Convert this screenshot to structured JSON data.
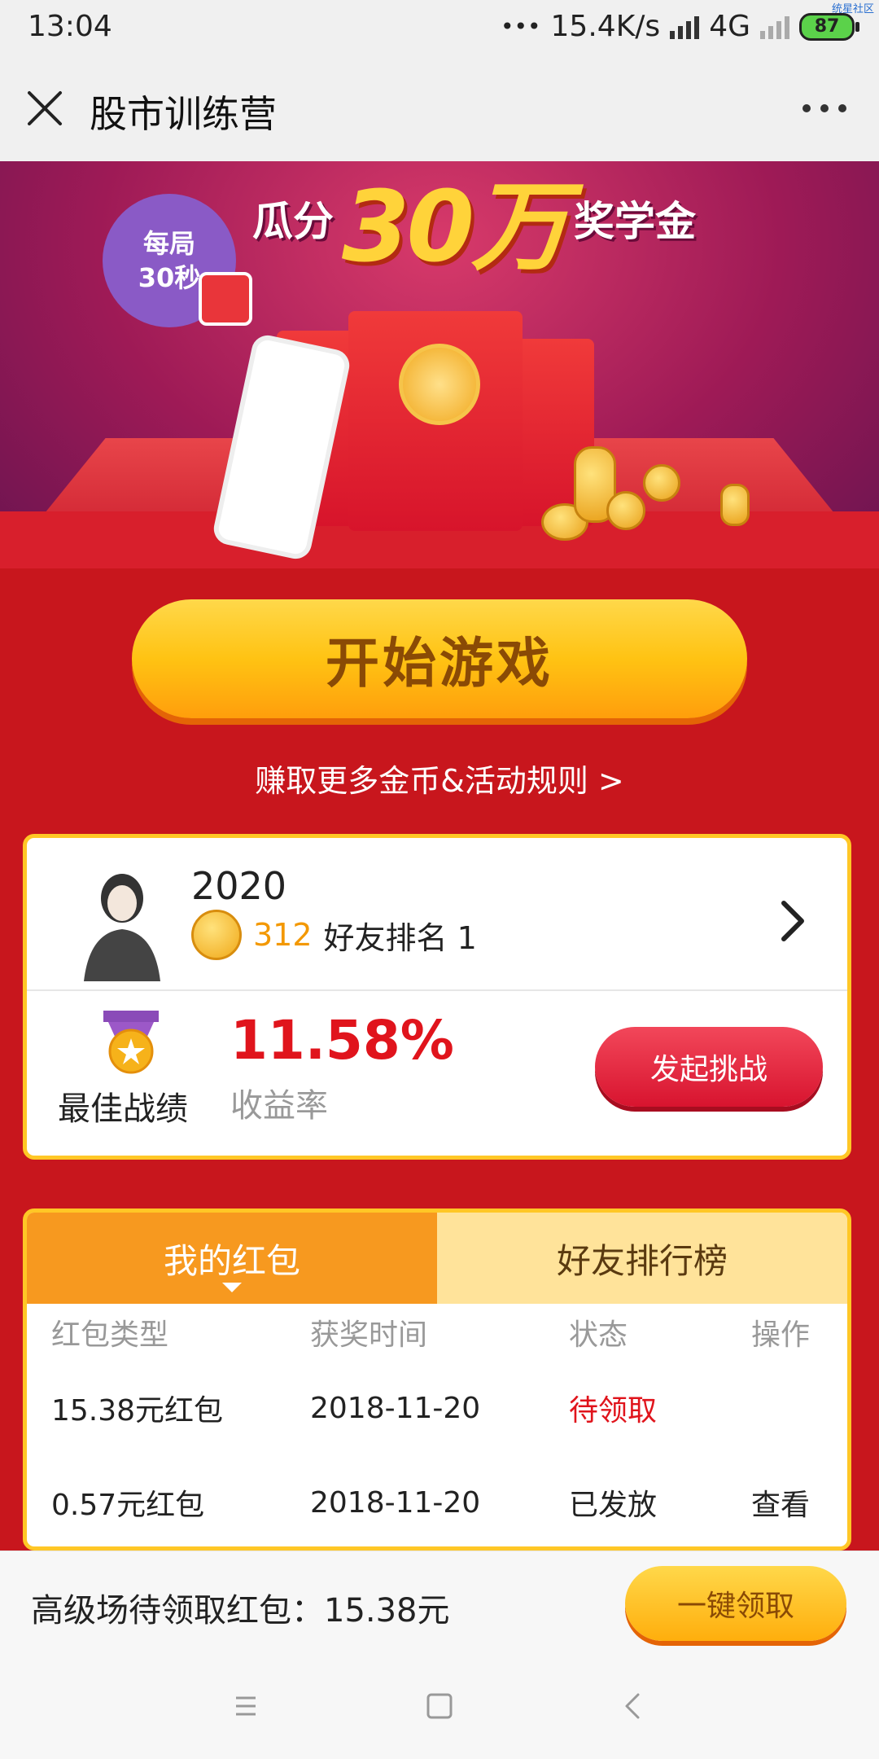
{
  "status_bar": {
    "time": "13:04",
    "network_speed": "15.4K/s",
    "network_type": "4G",
    "battery": "87",
    "watermark": "统星社区"
  },
  "nav": {
    "title": "股市训练营",
    "close_icon": "close-icon",
    "more_icon": "more-icon"
  },
  "banner": {
    "headline_left": "瓜分",
    "headline_amount": "30万",
    "headline_right": "奖学金",
    "badge_line1": "每局",
    "badge_line2": "30秒"
  },
  "start_button": "开始游戏",
  "rules_link": "赚取更多金币&活动规则 >",
  "profile": {
    "name": "2020",
    "coins": "312",
    "friend_rank": "好友排名 1",
    "best_label": "最佳战绩",
    "best_return": "11.58%",
    "return_label": "收益率",
    "challenge_button": "发起挑战"
  },
  "redpack": {
    "tabs": [
      "我的红包",
      "好友排行榜"
    ],
    "columns": [
      "红包类型",
      "获奖时间",
      "状态",
      "操作"
    ],
    "rows": [
      {
        "type": "15.38元红包",
        "date": "2018-11-20",
        "status": "待领取",
        "action": ""
      },
      {
        "type": "0.57元红包",
        "date": "2018-11-20",
        "status": "已发放",
        "action": "查看"
      }
    ]
  },
  "bottom_bar": {
    "pending_text": "高级场待领取红包：15.38元",
    "claim_button": "一键领取"
  },
  "colors": {
    "page_bg": "#c8161d",
    "accent_orange": "#f7991f",
    "gold_border": "#ffc726",
    "alert_red": "#e0141c"
  }
}
